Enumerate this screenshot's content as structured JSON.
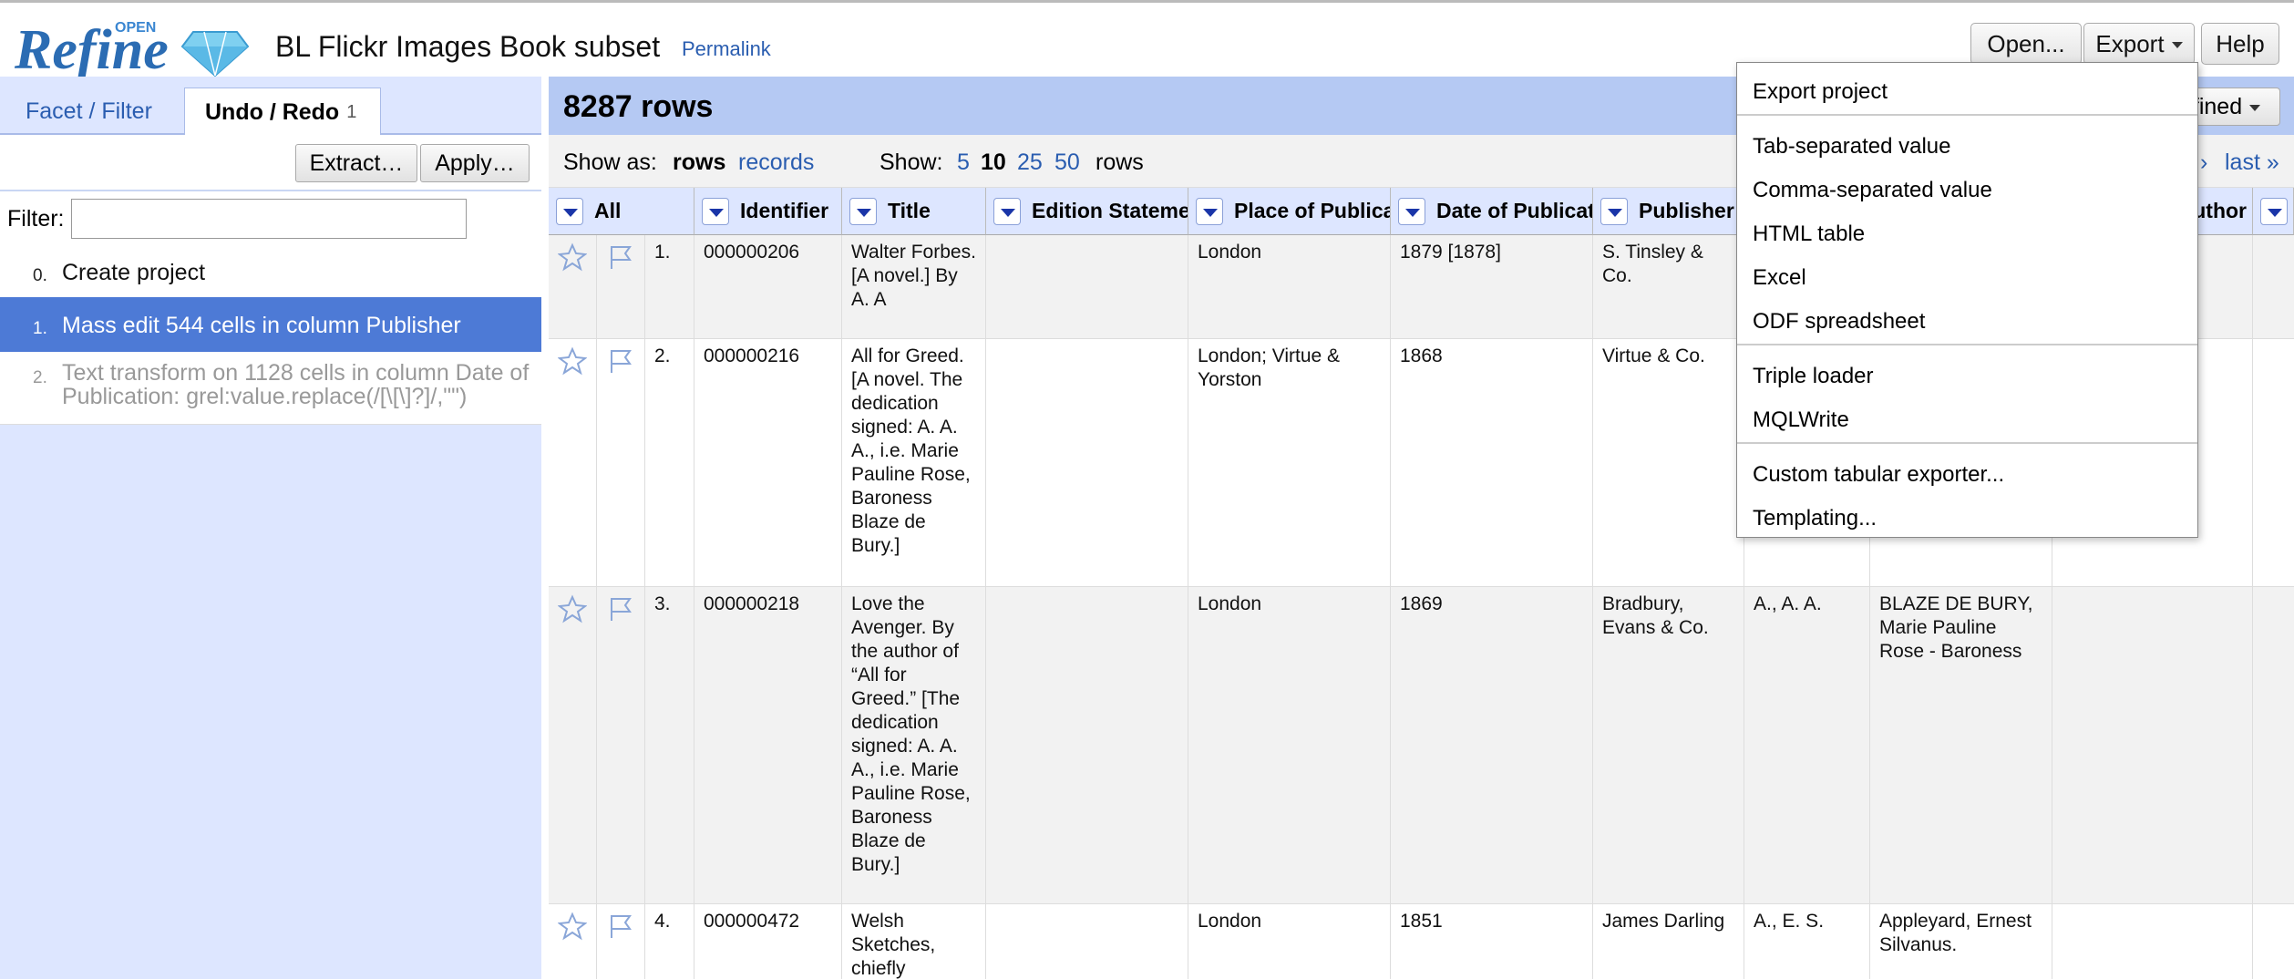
{
  "app": {
    "project_title": "BL Flickr Images Book subset",
    "permalink": "Permalink",
    "logo_open": "OPEN",
    "logo_refine": "Refine"
  },
  "header_buttons": {
    "open": "Open...",
    "export": "Export",
    "help": "Help"
  },
  "left_tabs": {
    "facet": "Facet / Filter",
    "undo": "Undo / Redo",
    "undo_count": "1"
  },
  "undo_toolbar": {
    "extract": "Extract…",
    "apply": "Apply…",
    "filter_label": "Filter:",
    "filter_value": ""
  },
  "history": [
    {
      "num": "0.",
      "text": "Create project"
    },
    {
      "num": "1.",
      "text": "Mass edit 544 cells in column Publisher"
    },
    {
      "num": "2.",
      "text": "Text transform on 1128 cells in column Date of Publication: grel:value.replace(/[\\[\\]?]/,\"\")"
    }
  ],
  "summary": {
    "row_count": "8287 rows",
    "mode_btn": "fined"
  },
  "view_controls": {
    "show_as": "Show as:",
    "rows": "rows",
    "records": "records",
    "show": "Show:",
    "sizes": [
      "5",
      "10",
      "25",
      "50"
    ],
    "rows_label": "rows",
    "next": "›",
    "last": "last »"
  },
  "columns": {
    "all": "All",
    "identifier": "Identifier",
    "title": "Title",
    "edition": "Edition Statement",
    "place": "Place of Publication",
    "date": "Date of Publication",
    "publisher": "Publisher",
    "author": "Author"
  },
  "rows": [
    {
      "idx": "1.",
      "identifier": "000000206",
      "title": "Walter Forbes. [A novel.] By A. A",
      "edition": "",
      "place": "London",
      "date": "1879 [1878]",
      "publisher": "S. Tinsley & Co.",
      "col8": "",
      "col9": ""
    },
    {
      "idx": "2.",
      "identifier": "000000216",
      "title": "All for Greed. [A novel. The dedication signed: A. A. A., i.e. Marie Pauline Rose, Baroness Blaze de Bury.]",
      "edition": "",
      "place": "London; Virtue & Yorston",
      "date": "1868",
      "publisher": "Virtue & Co.",
      "col8": "",
      "col9": ""
    },
    {
      "idx": "3.",
      "identifier": "000000218",
      "title": "Love the Avenger. By the author of “All for Greed.” [The dedication signed: A. A. A., i.e. Marie Pauline Rose, Baroness Blaze de Bury.]",
      "edition": "",
      "place": "London",
      "date": "1869",
      "publisher": "Bradbury, Evans & Co.",
      "col8": "A., A. A.",
      "col9": "BLAZE DE BURY, Marie Pauline Rose - Baroness"
    },
    {
      "idx": "4.",
      "identifier": "000000472",
      "title": "Welsh Sketches, chiefly",
      "edition": "",
      "place": "London",
      "date": "1851",
      "publisher": "James Darling",
      "col8": "A., E. S.",
      "col9": "Appleyard, Ernest Silvanus."
    }
  ],
  "export_menu": {
    "export_project": "Export project",
    "tsv": "Tab-separated value",
    "csv": "Comma-separated value",
    "html": "HTML table",
    "excel": "Excel",
    "ods": "ODF spreadsheet",
    "triple": "Triple loader",
    "mql": "MQLWrite",
    "custom": "Custom tabular exporter...",
    "templating": "Templating..."
  },
  "colors": {
    "accent": "#4d7ad6",
    "link": "#2a5db0",
    "panel": "#dde6ff",
    "summary": "#b5c9f3"
  }
}
